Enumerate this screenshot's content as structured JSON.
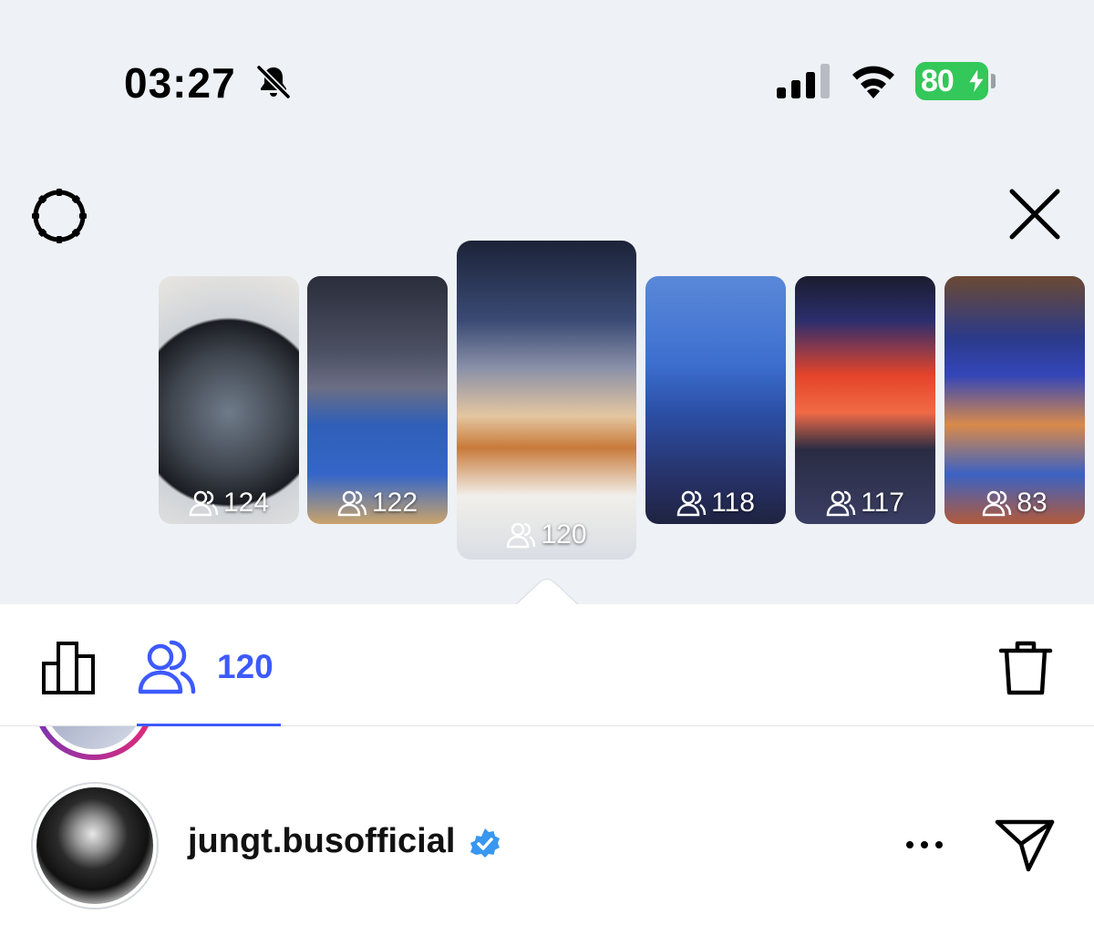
{
  "status_bar": {
    "time": "03:27",
    "battery": "80",
    "icons": [
      "bell-slash-icon",
      "cellular-signal-icon",
      "wifi-icon",
      "battery-charging-icon"
    ]
  },
  "header": {
    "icons": [
      "gear-icon",
      "close-icon"
    ]
  },
  "stories": [
    {
      "viewers": "124"
    },
    {
      "viewers": "122"
    },
    {
      "viewers": "120",
      "selected": true
    },
    {
      "viewers": "118"
    },
    {
      "viewers": "117"
    },
    {
      "viewers": "83"
    }
  ],
  "action_bar": {
    "viewer_count": "120",
    "accent_color": "#3d5afe",
    "icons": [
      "bar-chart-icon",
      "people-icon",
      "trash-icon"
    ]
  },
  "profile": {
    "username": "jungt.busofficial",
    "verified": true,
    "icons": [
      "verified-badge-icon",
      "more-icon",
      "send-icon"
    ]
  },
  "colors": {
    "background_top": "#eef1f5",
    "battery_green": "#34c759",
    "accent": "#3d5afe"
  }
}
